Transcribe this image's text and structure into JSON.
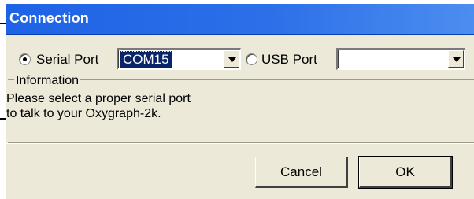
{
  "dialog": {
    "title": "Connection"
  },
  "connection": {
    "serial": {
      "label": "Serial Port",
      "selected": true,
      "value": "COM15"
    },
    "usb": {
      "label": "USB Port",
      "selected": false,
      "value": ""
    }
  },
  "information": {
    "legend": "Information",
    "lines": [
      "Please select a proper serial port",
      "to talk to your Oxygraph-2k."
    ]
  },
  "buttons": {
    "cancel": "Cancel",
    "ok": "OK"
  },
  "colors": {
    "titlebar": "#1e63e6",
    "dialog_bg": "#ece9d8",
    "selection": "#0a246a"
  }
}
